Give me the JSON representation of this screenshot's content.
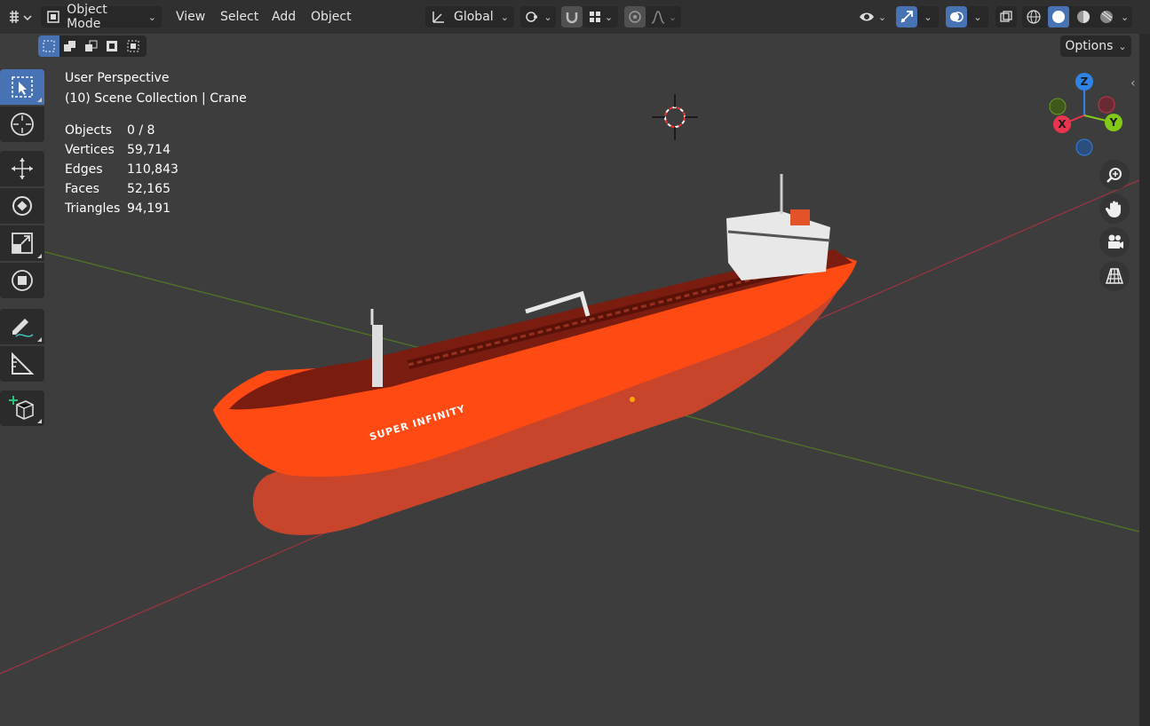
{
  "header": {
    "editor_type_icon": "editor-type-icon",
    "mode": "Object Mode",
    "menus": [
      "View",
      "Select",
      "Add",
      "Object"
    ],
    "transform_orientation": "Global"
  },
  "subheader": {
    "options_label": "Options"
  },
  "viewport": {
    "view_name": "User Perspective",
    "collection_line": "(10) Scene Collection | Crane",
    "stats": [
      {
        "label": "Objects",
        "value": "0 / 8"
      },
      {
        "label": "Vertices",
        "value": "59,714"
      },
      {
        "label": "Edges",
        "value": "110,843"
      },
      {
        "label": "Faces",
        "value": "52,165"
      },
      {
        "label": "Triangles",
        "value": "94,191"
      }
    ],
    "ship_name": "SUPER INFINITY"
  },
  "gizmo": {
    "x": "X",
    "y": "Y",
    "z": "Z"
  },
  "colors": {
    "accent": "#4772b3",
    "hull": "#ff4a14",
    "axis_x": "#c83a4a",
    "axis_y": "#6a9a2a",
    "gizmo_x": "#e8344f",
    "gizmo_y": "#82c918",
    "gizmo_z": "#2f83e4"
  }
}
